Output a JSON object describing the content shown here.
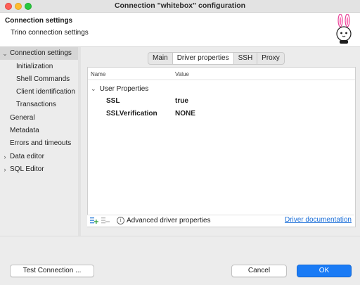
{
  "window": {
    "title": "Connection \"whitebox\" configuration"
  },
  "header": {
    "title": "Connection settings",
    "subtitle": "Trino connection settings"
  },
  "sidebar": {
    "items": [
      {
        "label": "Connection settings",
        "expander": "⌄"
      },
      {
        "label": "Initialization"
      },
      {
        "label": "Shell Commands"
      },
      {
        "label": "Client identification"
      },
      {
        "label": "Transactions"
      },
      {
        "label": "General"
      },
      {
        "label": "Metadata"
      },
      {
        "label": "Errors and timeouts"
      },
      {
        "label": "Data editor",
        "expander": "›"
      },
      {
        "label": "SQL Editor",
        "expander": "›"
      }
    ]
  },
  "tabs": [
    {
      "label": "Main"
    },
    {
      "label": "Driver properties"
    },
    {
      "label": "SSH"
    },
    {
      "label": "Proxy"
    }
  ],
  "properties_table": {
    "columns": [
      "Name",
      "Value"
    ],
    "group": {
      "label": "User Properties",
      "expander": "⌄"
    },
    "rows": [
      {
        "name": "SSL",
        "value": "true"
      },
      {
        "name": "SSLVerification",
        "value": "NONE"
      }
    ]
  },
  "bottom_bar": {
    "info_glyph": "i",
    "advanced_label": "Advanced driver properties",
    "driver_docs_link": "Driver documentation"
  },
  "buttons": {
    "test_connection": "Test Connection ...",
    "cancel": "Cancel",
    "ok": "OK"
  },
  "colors": {
    "accent": "#1a7bf5",
    "link": "#1a6ed8",
    "selection": "#d6d6d6"
  }
}
